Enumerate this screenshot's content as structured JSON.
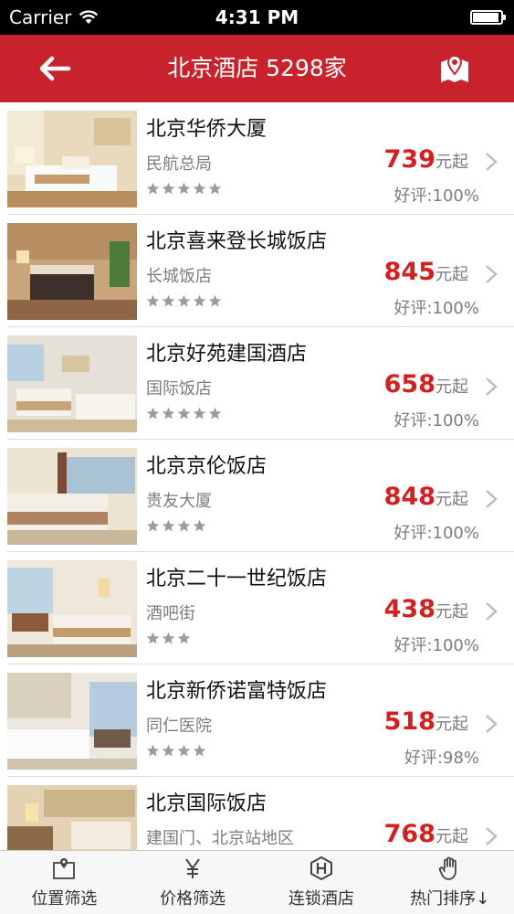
{
  "status_bar": {
    "carrier": "Carrier",
    "time": "4:31 PM",
    "battery_level": 0.95
  },
  "navbar": {
    "title": "北京酒店 5298家",
    "back_icon": "arrow-left-icon",
    "map_icon": "map-pin-icon"
  },
  "hotels": [
    {
      "name": "北京华侨大厦",
      "location": "民航总局",
      "stars": 5,
      "price": "739",
      "price_suffix": "元起",
      "rating": "好评:100%"
    },
    {
      "name": "北京喜来登长城饭店",
      "location": "长城饭店",
      "stars": 5,
      "price": "845",
      "price_suffix": "元起",
      "rating": "好评:100%"
    },
    {
      "name": "北京好苑建国酒店",
      "location": "国际饭店",
      "stars": 5,
      "price": "658",
      "price_suffix": "元起",
      "rating": "好评:100%"
    },
    {
      "name": "北京京伦饭店",
      "location": "贵友大厦",
      "stars": 4,
      "price": "848",
      "price_suffix": "元起",
      "rating": "好评:100%"
    },
    {
      "name": "北京二十一世纪饭店",
      "location": "酒吧街",
      "stars": 3,
      "price": "438",
      "price_suffix": "元起",
      "rating": "好评:100%"
    },
    {
      "name": "北京新侨诺富特饭店",
      "location": "同仁医院",
      "stars": 4,
      "price": "518",
      "price_suffix": "元起",
      "rating": "好评:98%"
    },
    {
      "name": "北京国际饭店",
      "location": "建国门、北京站地区",
      "stars": 0,
      "price": "768",
      "price_suffix": "元起",
      "rating": ""
    }
  ],
  "tabbar": {
    "tabs": [
      {
        "label": "位置筛选",
        "icon": "location-filter-icon"
      },
      {
        "label": "价格筛选",
        "icon": "yen-icon"
      },
      {
        "label": "连锁酒店",
        "icon": "hotel-chain-icon"
      },
      {
        "label": "热门排序↓",
        "icon": "hand-icon"
      }
    ]
  },
  "colors": {
    "brand_red": "#c8232c",
    "price_red": "#d32020"
  }
}
